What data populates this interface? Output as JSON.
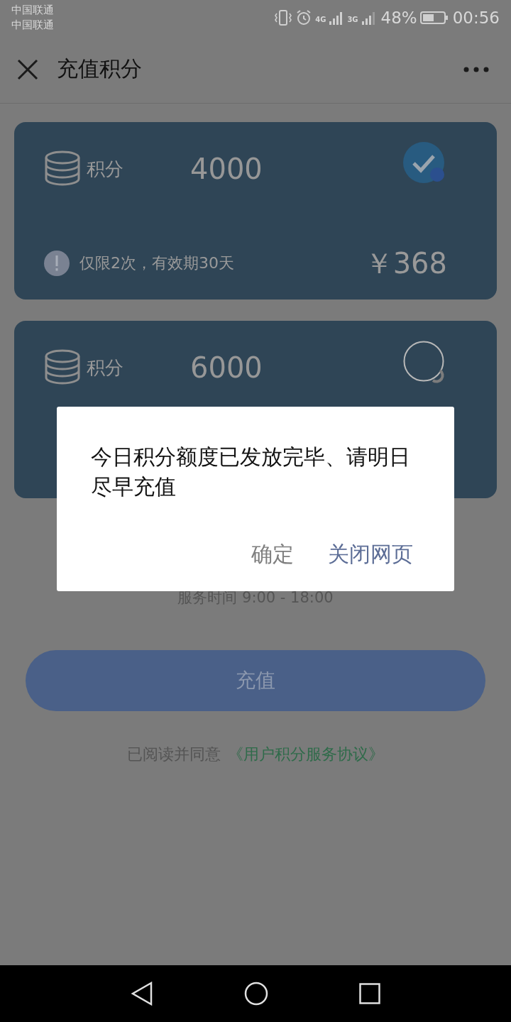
{
  "status_bar": {
    "carriers": [
      "中国联通",
      "中国联通"
    ],
    "network_1": "4G",
    "network_2": "3G",
    "battery": "48%",
    "time": "00:56"
  },
  "header": {
    "title": "充值积分"
  },
  "packages": [
    {
      "label": "积分",
      "points": "4000",
      "selected": true,
      "note": "仅限2次，有效期30天",
      "price": "￥368"
    },
    {
      "label": "积分",
      "points": "6000",
      "selected": false
    }
  ],
  "service_hours": "服务时间 9:00 - 18:00",
  "submit_button": "充值",
  "agreement": {
    "prefix": "已阅读并同意",
    "link": "《用户积分服务协议》"
  },
  "dialog": {
    "message": "今日积分额度已发放完毕、请明日尽早充值",
    "buttons": [
      {
        "label": "确定",
        "kind": "secondary"
      },
      {
        "label": "关闭网页",
        "kind": "primary"
      }
    ]
  }
}
